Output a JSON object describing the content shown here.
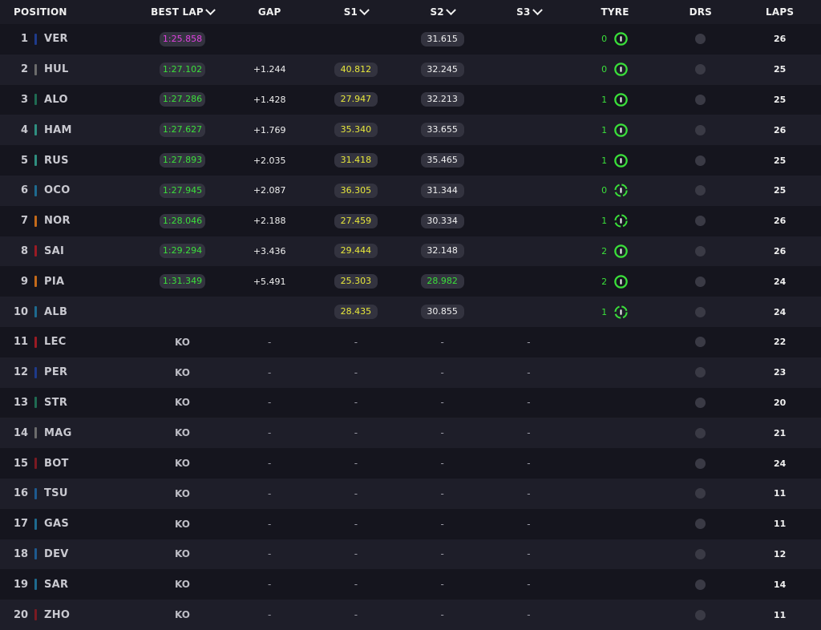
{
  "header": {
    "position": "POSITION",
    "best_lap": "BEST LAP",
    "gap": "GAP",
    "s1": "S1",
    "s2": "S2",
    "s3": "S3",
    "tyre": "TYRE",
    "drs": "DRS",
    "laps": "LAPS"
  },
  "colors": {
    "purple": "#e040e0",
    "green": "#3adf3a",
    "yellow": "#e8e83a"
  },
  "drivers": [
    {
      "pos": "1",
      "code": "VER",
      "team_color": "#1e3a8a",
      "best_lap": "1:25.858",
      "best_color": "purple",
      "gap": "",
      "s1": "",
      "s1_color": "",
      "s2": "31.615",
      "s2_color": "white",
      "s3": "",
      "tyre_age": "0",
      "tyre_icon": "hard-tyre-icon",
      "laps": "26"
    },
    {
      "pos": "2",
      "code": "HUL",
      "team_color": "#6b6b6b",
      "best_lap": "1:27.102",
      "best_color": "green",
      "gap": "+1.244",
      "s1": "40.812",
      "s1_color": "yellow",
      "s2": "32.245",
      "s2_color": "white",
      "s3": "",
      "tyre_age": "0",
      "tyre_icon": "hard-tyre-icon",
      "laps": "25"
    },
    {
      "pos": "3",
      "code": "ALO",
      "team_color": "#1f6b52",
      "best_lap": "1:27.286",
      "best_color": "green",
      "gap": "+1.428",
      "s1": "27.947",
      "s1_color": "yellow",
      "s2": "32.213",
      "s2_color": "white",
      "s3": "",
      "tyre_age": "1",
      "tyre_icon": "hard-tyre-icon",
      "laps": "25"
    },
    {
      "pos": "4",
      "code": "HAM",
      "team_color": "#2f8f80",
      "best_lap": "1:27.627",
      "best_color": "green",
      "gap": "+1.769",
      "s1": "35.340",
      "s1_color": "yellow",
      "s2": "33.655",
      "s2_color": "white",
      "s3": "",
      "tyre_age": "1",
      "tyre_icon": "hard-tyre-icon",
      "laps": "26"
    },
    {
      "pos": "5",
      "code": "RUS",
      "team_color": "#2f8f80",
      "best_lap": "1:27.893",
      "best_color": "green",
      "gap": "+2.035",
      "s1": "31.418",
      "s1_color": "yellow",
      "s2": "35.465",
      "s2_color": "white",
      "s3": "",
      "tyre_age": "1",
      "tyre_icon": "hard-tyre-icon",
      "laps": "25"
    },
    {
      "pos": "6",
      "code": "OCO",
      "team_color": "#1e6a8f",
      "best_lap": "1:27.945",
      "best_color": "green",
      "gap": "+2.087",
      "s1": "36.305",
      "s1_color": "yellow",
      "s2": "31.344",
      "s2_color": "white",
      "s3": "",
      "tyre_age": "0",
      "tyre_icon": "intermediate-tyre-icon",
      "laps": "25"
    },
    {
      "pos": "7",
      "code": "NOR",
      "team_color": "#c46a1a",
      "best_lap": "1:28.046",
      "best_color": "green",
      "gap": "+2.188",
      "s1": "27.459",
      "s1_color": "yellow",
      "s2": "30.334",
      "s2_color": "white",
      "s3": "",
      "tyre_age": "1",
      "tyre_icon": "intermediate-tyre-icon",
      "laps": "26"
    },
    {
      "pos": "8",
      "code": "SAI",
      "team_color": "#9a1b24",
      "best_lap": "1:29.294",
      "best_color": "green",
      "gap": "+3.436",
      "s1": "29.444",
      "s1_color": "yellow",
      "s2": "32.148",
      "s2_color": "white",
      "s3": "",
      "tyre_age": "2",
      "tyre_icon": "hard-tyre-icon",
      "laps": "26"
    },
    {
      "pos": "9",
      "code": "PIA",
      "team_color": "#c46a1a",
      "best_lap": "1:31.349",
      "best_color": "green",
      "gap": "+5.491",
      "s1": "25.303",
      "s1_color": "yellow",
      "s2": "28.982",
      "s2_color": "green",
      "s3": "",
      "tyre_age": "2",
      "tyre_icon": "hard-tyre-icon",
      "laps": "24"
    },
    {
      "pos": "10",
      "code": "ALB",
      "team_color": "#1e6a8f",
      "best_lap": "",
      "best_color": "",
      "gap": "",
      "s1": "28.435",
      "s1_color": "yellow",
      "s2": "30.855",
      "s2_color": "white",
      "s3": "",
      "tyre_age": "1",
      "tyre_icon": "intermediate-tyre-icon",
      "laps": "24"
    },
    {
      "pos": "11",
      "code": "LEC",
      "team_color": "#9a1b24",
      "ko": "KO",
      "laps": "22"
    },
    {
      "pos": "12",
      "code": "PER",
      "team_color": "#1e3a8a",
      "ko": "KO",
      "laps": "23"
    },
    {
      "pos": "13",
      "code": "STR",
      "team_color": "#1f6b52",
      "ko": "KO",
      "laps": "20"
    },
    {
      "pos": "14",
      "code": "MAG",
      "team_color": "#6b6b6b",
      "ko": "KO",
      "laps": "21"
    },
    {
      "pos": "15",
      "code": "BOT",
      "team_color": "#7a1a22",
      "ko": "KO",
      "laps": "24"
    },
    {
      "pos": "16",
      "code": "TSU",
      "team_color": "#1e5a8f",
      "ko": "KO",
      "laps": "11"
    },
    {
      "pos": "17",
      "code": "GAS",
      "team_color": "#1e6a8f",
      "ko": "KO",
      "laps": "11"
    },
    {
      "pos": "18",
      "code": "DEV",
      "team_color": "#1e5a8f",
      "ko": "KO",
      "laps": "12"
    },
    {
      "pos": "19",
      "code": "SAR",
      "team_color": "#1e6a8f",
      "ko": "KO",
      "laps": "14"
    },
    {
      "pos": "20",
      "code": "ZHO",
      "team_color": "#7a1a22",
      "ko": "KO",
      "laps": "11"
    }
  ],
  "dash": "-"
}
